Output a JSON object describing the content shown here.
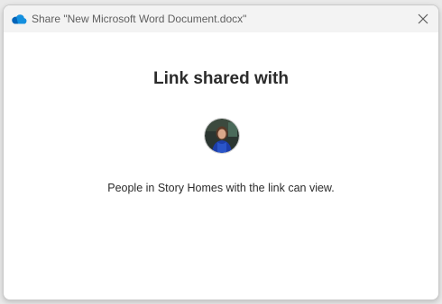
{
  "window": {
    "title": "Share \"New Microsoft Word Document.docx\""
  },
  "main": {
    "heading": "Link shared with",
    "description": "People in Story Homes with the link can view."
  },
  "icons": {
    "app": "onedrive-cloud-icon",
    "close": "close-icon",
    "avatar": "user-avatar"
  },
  "colors": {
    "accent": "#0078d4",
    "titlebar": "#f3f3f3"
  }
}
